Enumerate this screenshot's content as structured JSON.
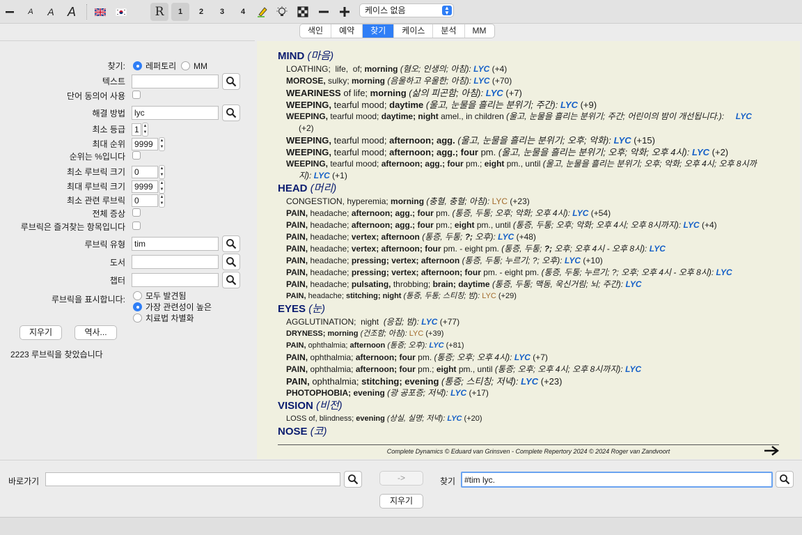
{
  "toolbar": {
    "selected_book_label": "케이스 없음",
    "numbers": [
      "1",
      "2",
      "3",
      "4"
    ],
    "r_label": "R"
  },
  "tabs": [
    "색인",
    "예약",
    "찾기",
    "케이스",
    "분석",
    "MM"
  ],
  "form": {
    "find_label": "찾기:",
    "find_opt_repertory": "레퍼토리",
    "find_opt_mm": "MM",
    "text_label": "텍스트",
    "text_value": "",
    "synonyms_label": "단어 동의어 사용",
    "remedy_label": "해결 방법",
    "remedy_value": "lyc",
    "min_grade_label": "최소 등급",
    "min_grade_value": "1",
    "max_rank_label": "최대 순위",
    "max_rank_value": "9999",
    "rank_percent_label": "순위는 %입니다",
    "min_rubric_size_label": "최소 루브릭 크기",
    "min_rubric_size_value": "0",
    "max_rubric_size_label": "최대 루브릭 크기",
    "max_rubric_size_value": "9999",
    "min_related_label": "최소 관련 루브릭",
    "min_related_value": "0",
    "all_symptoms_label": "전체 증상",
    "favorites_label": "루브릭은 즐겨찾는 항목입니다",
    "rubric_type_label": "루브릭 유형",
    "rubric_type_value": "tim",
    "book_label": "도서",
    "book_value": "",
    "chapter_label": "챕터",
    "chapter_value": "",
    "show_label": "루브릭을 표시합니다:",
    "show_opt_all": "모두 발견됨",
    "show_opt_relevant": "가장 관련성이 높은",
    "show_opt_diff": "치료법 차별화",
    "clear_button": "지우기",
    "history_button": "역사...",
    "found_text": "2223 루브릭을 찾았습니다"
  },
  "results": {
    "sections": [
      {
        "title": "MIND",
        "translation": "(마음)",
        "rubrics": [
          {
            "html": "LOATHING;&nbsp; life,&nbsp; of; <b>morning</b> <span class='tr'>(혐오; 인생의; 아침):</span> <span class='lyc'>LYC</span> (+4)"
          },
          {
            "html": "<b>MOROSE,</b> sulky; <b>morning</b> <span class='tr'>(음울하고 우울한; 아침):</span> <span class='lyc'>LYC</span> (+70)"
          },
          {
            "cls": "lg",
            "html": "<b>WEARINESS</b> of life; <b>morning</b> <span class='tr'>(삶의 피곤함; 아침):</span> <span class='lyc'>LYC</span> (+7)"
          },
          {
            "cls": "lg",
            "html": "<b>WEEPING,</b> tearful mood; <b>daytime</b> <span class='tr'>(울고, 눈물을 흘리는 분위기; 주간):</span> <span class='lyc'>LYC</span> (+9)"
          },
          {
            "hang": true,
            "html": "<b>WEEPING,</b> tearful mood; <b>daytime; night</b> amel., in children <span class='tr'>(울고, 눈물을 흘리는 분위기; 주간; 어린이의 밤이 개선됩니다.):</span> &nbsp;&nbsp;&nbsp;&nbsp;<span class='lyc'>LYC</span> (+2)"
          },
          {
            "cls": "lg",
            "html": "<b>WEEPING,</b> tearful mood; <b>afternoon; agg.</b> <span class='tr'>(울고, 눈물을 흘리는 분위기; 오후; 악화):</span> <span class='lyc'>LYC</span> (+15)"
          },
          {
            "cls": "lg",
            "html": "<b>WEEPING,</b> tearful mood; <b>afternoon; agg.; four</b> pm. <span class='tr'>(울고, 눈물을 흘리는 분위기; 오후; 악화; 오후 4시):</span> <span class='lyc'>LYC</span> (+2)"
          },
          {
            "hang": true,
            "html": "<b>WEEPING,</b> tearful mood; <b>afternoon; agg.; four</b> pm.; <b>eight</b> pm., until <span class='tr'>(울고, 눈물을 흘리는 분위기; 오후; 악화; 오후 4시; 오후 8시까지):</span> <span class='lyc'>LYC</span> (+1)"
          }
        ]
      },
      {
        "title": "HEAD",
        "translation": "(머리)",
        "rubrics": [
          {
            "html": "CONGESTION, hyperemia; <b>morning</b> <span class='tr'>(충혈, 충혈; 아침):</span> <span class='lyc br'>LYC</span> (+23)"
          },
          {
            "html": "<b>PAIN,</b> headache; <b>afternoon; agg.; four</b> pm. <span class='tr'>(통증, 두통; 오후; 악화; 오후 4시):</span> <span class='lyc'>LYC</span> (+54)"
          },
          {
            "html": "<b>PAIN,</b> headache; <b>afternoon; agg.; four</b> pm.; <b>eight</b> pm., until <span class='tr'>(통증, 두통; 오후; 악화; 오후 4시; 오후 8시까지):</span> <span class='lyc'>LYC</span> (+4)"
          },
          {
            "html": "<b>PAIN,</b> headache; <b>vertex; afternoon</b> <span class='tr'>(통증, 두통; <b>?;</b> 오후):</span> <span class='lyc'>LYC</span> (+48)"
          },
          {
            "html": "<b>PAIN,</b> headache; <b>vertex; afternoon; four</b> pm. - eight pm. <span class='tr'>(통증, 두통; <b>?;</b> 오후; 오후 4시 - 오후 8시):</span> <span class='lyc'>LYC</span>"
          },
          {
            "html": "<b>PAIN,</b> headache; <b>pressing; vertex; afternoon</b> <span class='tr'>(통증, 두통; 누르기; ?; 오후):</span> <span class='lyc'>LYC</span> (+10)"
          },
          {
            "html": "<b>PAIN,</b> headache; <b>pressing; vertex; afternoon; four</b> pm. - eight pm. <span class='tr'>(통증, 두통; 누르기; ?; 오후; 오후 4시 - 오후 8시):</span> <span class='lyc'>LYC</span>"
          },
          {
            "html": "<b>PAIN,</b> headache; <b>pulsating,</b> throbbing; <b>brain; daytime</b> <span class='tr'>(통증, 두통; 맥동, 욱신거림; 뇌; 주간):</span> <span class='lyc'>LYC</span>"
          },
          {
            "cls": "sm",
            "html": "<b>PAIN,</b> headache; <b>stitching; night</b> <span class='tr'>(통증, 두통; 스티칭; 밤):</span> <span class='lyc br'>LYC</span> (+29)"
          }
        ]
      },
      {
        "title": "EYES",
        "translation": "(눈)",
        "rubrics": [
          {
            "html": "AGGLUTINATION;&nbsp; night&nbsp; <span class='tr'>(응집; 밤):</span> <span class='lyc'>LYC</span> (+77)"
          },
          {
            "cls": "sm",
            "html": "<b>DRYNESS; morning</b> <span class='tr'>(건조함; 아침):</span> <span class='lyc br'>LYC</span> (+39)"
          },
          {
            "cls": "sm",
            "html": "<b>PAIN,</b> ophthalmia; <b>afternoon</b> <span class='tr'>(통증; 오후):</span> <span class='lyc'>LYC</span> (+81)"
          },
          {
            "html": "<b>PAIN,</b> ophthalmia; <b>afternoon; four</b> pm. <span class='tr'>(통증; 오후; 오후 4시):</span> <span class='lyc'>LYC</span> (+7)"
          },
          {
            "html": "<b>PAIN,</b> ophthalmia; <b>afternoon; four</b> pm.; <b>eight</b> pm., until <span class='tr'>(통증; 오후; 오후 4시; 오후 8시까지):</span> <span class='lyc'>LYC</span>"
          },
          {
            "cls": "lg",
            "html": "<b>PAIN,</b> ophthalmia; <b>stitching; evening</b> <span class='tr'>(통증; 스티칭; 저녁):</span> <span class='lyc'>LYC</span> (+23)"
          },
          {
            "html": "<b>PHOTOPHOBIA; evening</b> <span class='tr'>(광 공포증; 저녁):</span> <span class='lyc'>LYC</span> (+17)"
          }
        ]
      },
      {
        "title": "VISION",
        "translation": "(비전)",
        "rubrics": [
          {
            "cls": "sm",
            "html": "LOSS of, blindness; <b>evening</b> <span class='tr'>(상실, 실명; 저녁):</span> <span class='lyc'>LYC</span> (+20)"
          }
        ]
      },
      {
        "title": "NOSE",
        "translation": "(코)",
        "rubrics": []
      }
    ],
    "footer": "Complete Dynamics © Eduard van Grinsven   -   Complete Repertory 2024 © 2024 Roger van Zandvoort"
  },
  "bottom": {
    "goto_label": "바로가기",
    "goto_value": "",
    "arrow_button": "->",
    "clear_button": "지우기",
    "find_label": "찾기",
    "find_value": "#tim lyc."
  }
}
